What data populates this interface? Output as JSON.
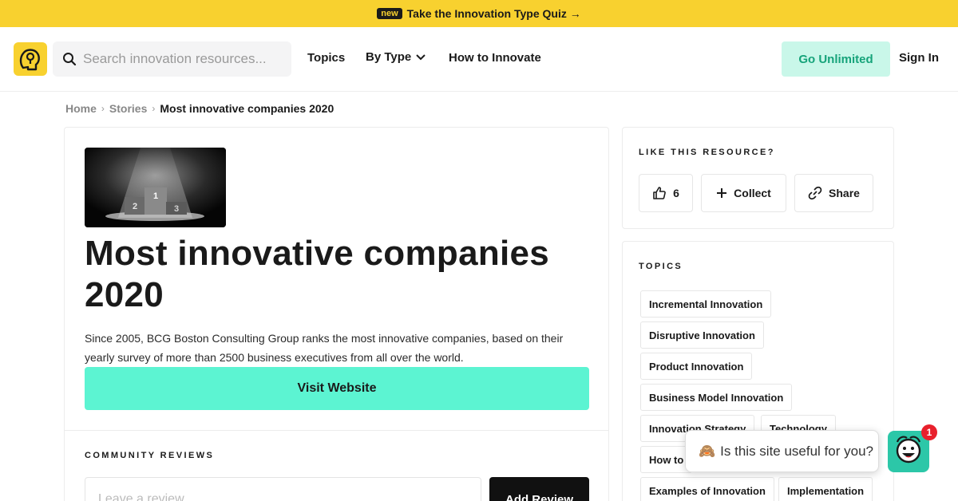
{
  "promo": {
    "badge": "new",
    "text": "Take the Innovation Type Quiz →"
  },
  "header": {
    "search_placeholder": "Search innovation resources...",
    "nav": {
      "topics": "Topics",
      "by_type": "By Type",
      "how_to_innovate": "How to Innovate"
    },
    "go_unlimited": "Go Unlimited",
    "sign_in": "Sign In"
  },
  "breadcrumb": {
    "home": "Home",
    "stories": "Stories",
    "current": "Most innovative companies 2020"
  },
  "resource": {
    "thumbnail_labels": [
      "2",
      "1",
      "3"
    ],
    "title": "Most innovative companies 2020",
    "description": "Since 2005, BCG Boston Consulting Group ranks the most innovative companies, based on their yearly survey of more than 2500 business executives from all over the world.",
    "visit_button": "Visit Website"
  },
  "reviews": {
    "label": "Community Reviews",
    "placeholder": "Leave a review...",
    "add_button": "Add Review"
  },
  "like_section": {
    "label": "Like this resource?",
    "like_count": "6",
    "collect": "Collect",
    "share": "Share"
  },
  "topics": {
    "label": "Topics",
    "tags": [
      "Incremental Innovation",
      "Disruptive Innovation",
      "Product Innovation",
      "Business Model Innovation",
      "Innovation Strategy",
      "Technology",
      "How to",
      "Examples of Innovation",
      "Implementation"
    ]
  },
  "popup": {
    "emoji": "🙈",
    "text": "Is this site useful for you?"
  },
  "chat": {
    "badge_count": "1"
  },
  "colors": {
    "brand_yellow": "#f8d12f",
    "accent_mint": "#5cf4d2",
    "unlimited_bg": "#c9f7e9",
    "chat_teal": "#2cc7a8",
    "badge_red": "#e8202c"
  }
}
